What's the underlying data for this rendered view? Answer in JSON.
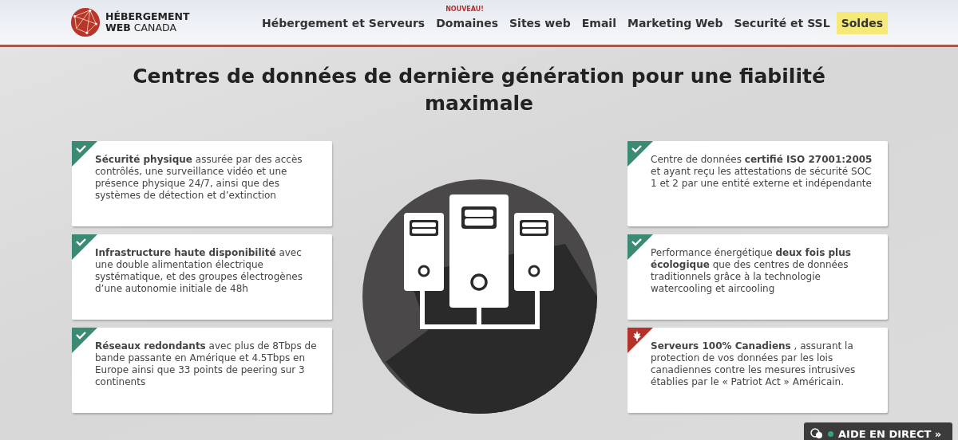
{
  "header": {
    "logo": {
      "line1": "HÉBERGEMENT",
      "line2_bold": "WEB",
      "line2": "CANADA"
    },
    "nav": [
      {
        "label": "Hébergement et Serveurs",
        "highlight": false
      },
      {
        "badge": "NOUVEAU!",
        "label": "Domaines",
        "highlight": false
      },
      {
        "label": "Sites web",
        "highlight": false
      },
      {
        "label": "Email",
        "highlight": false
      },
      {
        "label": "Marketing Web",
        "highlight": false
      },
      {
        "label": "Securité et SSL",
        "highlight": false
      },
      {
        "label": "Soldes",
        "highlight": true
      }
    ]
  },
  "title": "Centres de données de dernière génération pour une fiabilité maximale",
  "features_left": [
    {
      "kind": "check",
      "text": "**Sécurité physique** assurée par des accès contrôlés, une surveillance vidéo et une présence physique 24/7, ainsi que des systèmes de détection et d’extinction"
    },
    {
      "kind": "check",
      "text": "**Infrastructure haute disponibilité** avec une double alimentation électrique systématique, et des groupes électrogènes d’une autonomie initiale de 48h"
    },
    {
      "kind": "check",
      "text": "**Réseaux redondants** avec plus de 8Tbps de bande passante en Amérique et 4.5Tbps en Europe ainsi que 33 points de peering sur 3 continents"
    }
  ],
  "features_right": [
    {
      "kind": "check",
      "text": "Centre de données **certifié ISO 27001:2005** et ayant reçu les attestations de sécurité SOC 1 et 2 par une entité externe et indépendante"
    },
    {
      "kind": "check",
      "text": "Performance énergétique **deux fois plus écologique** que des centres de données traditionnels grâce à la technologie watercooling et aircooling"
    },
    {
      "kind": "maple",
      "text": "**Serveurs 100% Canadiens** , assurant la protection de vos données par les lois canadiennes contre les mesures intrusives établies par le « Patriot Act » Américain."
    }
  ],
  "chat_button": {
    "label": "AIDE EN DIRECT »"
  }
}
